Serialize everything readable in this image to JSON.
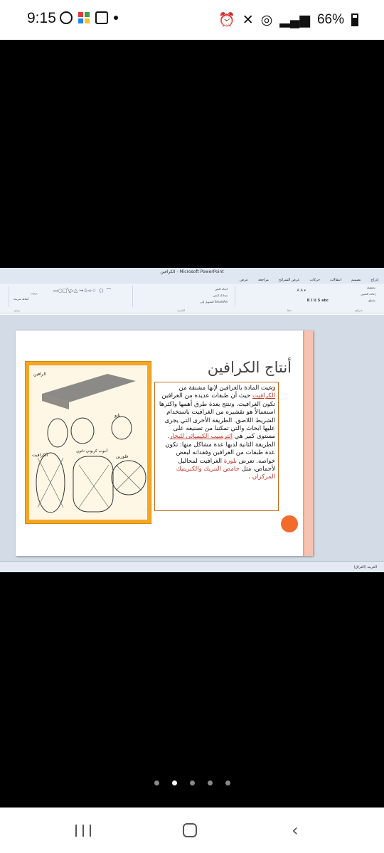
{
  "status_bar": {
    "time": "9:15",
    "battery": "66%"
  },
  "powerpoint": {
    "window_title": "الكرافين - Microsoft PowerPoint",
    "tabs": [
      "إدراج",
      "تصميم",
      "انتقالات",
      "حركات",
      "عرض الشرائح",
      "مراجعة",
      "عرض"
    ],
    "ribbon_groups": {
      "slides": "شرائح",
      "font": "خط",
      "paragraph": "الفقرة",
      "drawing": "رسم"
    },
    "ribbon_buttons": {
      "layout": "تخطيط",
      "reset": "إعادة التعيين",
      "section": "مقطع",
      "text_direction": "اتجاه النص",
      "align_text": "محاذاة النص",
      "convert_smartart": "التحويل إلى SmartArt",
      "arrange": "ترتيب",
      "quick_styles": "أنماط سريعة"
    },
    "statusbar_lang": "العربية (العراق)"
  },
  "slide": {
    "title": "أنتاج الكرافين",
    "body_segments": [
      {
        "text": "دعيت المادة بالغرافين لإنها مشتقة من ",
        "style": "normal"
      },
      {
        "text": "الكرافيت",
        "style": "red-underline"
      },
      {
        "text": " حيث أن طبقات عديدة من الغرافين تكون الغرافيت. وتنتج بعدة طرق أهمها واكثرها استعمالاً هو تقشيره من الغرافيت باستخدام الشريط اللاصق. الطريقة الأخرى التي يجرى عليها ابحاث والتي تمكننا من تصنيعه على مستوى كبير هي ",
        "style": "normal"
      },
      {
        "text": "الترسيب الكيميائي للبخار",
        "style": "red-underline"
      },
      {
        "text": ". الطريقة الثانية لديها عدة مشاكل منها: تكون عدة طبقات من الغرافين وفقدانه لبعض خواصه. تعرض ",
        "style": "normal"
      },
      {
        "text": "بلورة",
        "style": "red"
      },
      {
        "text": " الغرافيت لمحاليل لأحماض، مثل ",
        "style": "normal"
      },
      {
        "text": "حامض النتريك والكبريتيك المركزان",
        "style": "red"
      },
      {
        "text": " .",
        "style": "normal"
      }
    ],
    "image_labels": [
      "الرافين",
      "نانو",
      "فلورين",
      "أنبوب كربوني نانوي",
      "الكرافيت"
    ]
  },
  "pager": {
    "count": 5,
    "active_index": 1
  },
  "colors": {
    "accent_orange": "#f26b2a",
    "image_bg": "#f5a623",
    "text_highlight": "#c0392b"
  }
}
